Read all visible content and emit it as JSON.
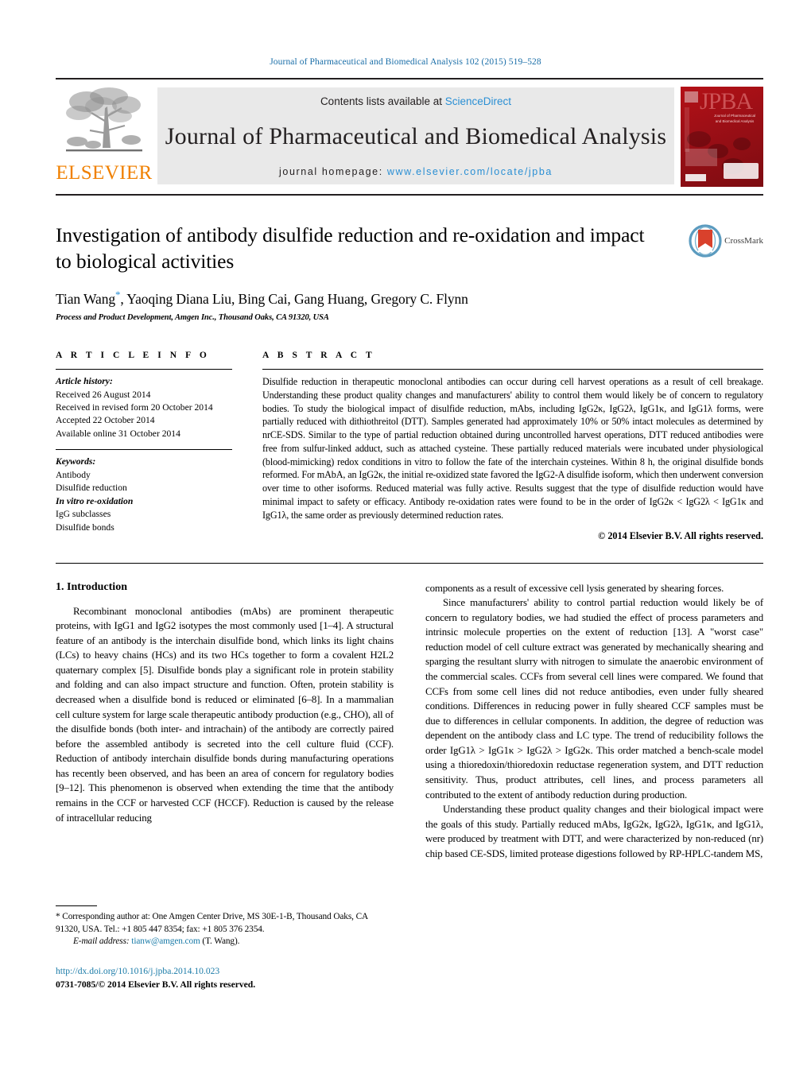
{
  "running_head": "Journal of Pharmaceutical and Biomedical Analysis 102 (2015) 519–528",
  "masthead": {
    "publisher_name": "ELSEVIER",
    "contents_prefix": "Contents lists available at ",
    "contents_link": "ScienceDirect",
    "journal_title": "Journal of Pharmaceutical and Biomedical Analysis",
    "homepage_prefix": "journal homepage: ",
    "homepage_url": "www.elsevier.com/locate/jpba",
    "cover_acronym": "JPBA",
    "cover_subtitle": "Journal of Pharmaceutical and Biomedical Analysis"
  },
  "article": {
    "title": "Investigation of antibody disulfide reduction and re-oxidation and impact to biological activities",
    "authors": "Tian Wang*, Yaoqing Diana Liu, Bing Cai, Gang Huang, Gregory C. Flynn",
    "authors_before_star": "Tian Wang",
    "authors_after_star": ", Yaoqing Diana Liu, Bing Cai, Gang Huang, Gregory C. Flynn",
    "affiliation": "Process and Product Development, Amgen Inc., Thousand Oaks, CA 91320, USA",
    "crossmark_label": "CrossMark"
  },
  "article_info": {
    "heading": "A R T I C L E   I N F O",
    "history_label": "Article history:",
    "history": [
      "Received 26 August 2014",
      "Received in revised form 20 October 2014",
      "Accepted 22 October 2014",
      "Available online 31 October 2014"
    ],
    "keywords_label": "Keywords:",
    "keywords": [
      "Antibody",
      "Disulfide reduction",
      "In vitro re-oxidation",
      "IgG subclasses",
      "Disulfide bonds"
    ]
  },
  "abstract": {
    "heading": "A B S T R A C T",
    "text": "Disulfide reduction in therapeutic monoclonal antibodies can occur during cell harvest operations as a result of cell breakage. Understanding these product quality changes and manufacturers' ability to control them would likely be of concern to regulatory bodies. To study the biological impact of disulfide reduction, mAbs, including IgG2κ, IgG2λ, IgG1κ, and IgG1λ forms, were partially reduced with dithiothreitol (DTT). Samples generated had approximately 10% or 50% intact molecules as determined by nrCE-SDS. Similar to the type of partial reduction obtained during uncontrolled harvest operations, DTT reduced antibodies were free from sulfur-linked adduct, such as attached cysteine. These partially reduced materials were incubated under physiological (blood-mimicking) redox conditions in vitro to follow the fate of the interchain cysteines. Within 8 h, the original disulfide bonds reformed. For mAbA, an IgG2κ, the initial re-oxidized state favored the IgG2-A disulfide isoform, which then underwent conversion over time to other isoforms. Reduced material was fully active. Results suggest that the type of disulfide reduction would have minimal impact to safety or efficacy. Antibody re-oxidation rates were found to be in the order of IgG2κ < IgG2λ < IgG1κ and IgG1λ, the same order as previously determined reduction rates.",
    "copyright": "© 2014 Elsevier B.V. All rights reserved."
  },
  "body": {
    "section_number_title": "1.  Introduction",
    "left_paragraphs": [
      "Recombinant monoclonal antibodies (mAbs) are prominent therapeutic proteins, with IgG1 and IgG2 isotypes the most commonly used [1–4]. A structural feature of an antibody is the interchain disulfide bond, which links its light chains (LCs) to heavy chains (HCs) and its two HCs together to form a covalent H2L2 quaternary complex [5]. Disulfide bonds play a significant role in protein stability and folding and can also impact structure and function. Often, protein stability is decreased when a disulfide bond is reduced or eliminated [6–8]. In a mammalian cell culture system for large scale therapeutic antibody production (e.g., CHO), all of the disulfide bonds (both inter- and intrachain) of the antibody are correctly paired before the assembled antibody is secreted into the cell culture fluid (CCF). Reduction of antibody interchain disulfide bonds during manufacturing operations has recently been observed, and has been an area of concern for regulatory bodies [9–12]. This phenomenon is observed when extending the time that the antibody remains in the CCF or harvested CCF (HCCF). Reduction is caused by the release of intracellular reducing"
    ],
    "right_paragraphs": [
      "components as a result of excessive cell lysis generated by shearing forces.",
      "Since manufacturers' ability to control partial reduction would likely be of concern to regulatory bodies, we had studied the effect of process parameters and intrinsic molecule properties on the extent of reduction [13]. A \"worst case\" reduction model of cell culture extract was generated by mechanically shearing and sparging the resultant slurry with nitrogen to simulate the anaerobic environment of the commercial scales. CCFs from several cell lines were compared. We found that CCFs from some cell lines did not reduce antibodies, even under fully sheared conditions. Differences in reducing power in fully sheared CCF samples must be due to differences in cellular components. In addition, the degree of reduction was dependent on the antibody class and LC type. The trend of reducibility follows the order IgG1λ > IgG1κ > IgG2λ > IgG2κ. This order matched a bench-scale model using a thioredoxin/thioredoxin reductase regeneration system, and DTT reduction sensitivity. Thus, product attributes, cell lines, and process parameters all contributed to the extent of antibody reduction during production.",
      "Understanding these product quality changes and their biological impact were the goals of this study. Partially reduced mAbs, IgG2κ, IgG2λ, IgG1κ, and IgG1λ, were produced by treatment with DTT, and were characterized by non-reduced (nr) chip based CE-SDS, limited protease digestions followed by RP-HPLC-tandem MS,"
    ]
  },
  "footnote": {
    "corresponding_line1": "* Corresponding author at: One Amgen Center Drive, MS 30E-1-B, Thousand Oaks,",
    "corresponding_line2": "CA 91320, USA. Tel.: +1 805 447 8354; fax: +1 805 376 2354.",
    "email_label": "E-mail address:",
    "email": "tianw@amgen.com",
    "email_suffix": " (T. Wang).",
    "doi": "http://dx.doi.org/10.1016/j.jpba.2014.10.023",
    "issn_copyright": "0731-7085/© 2014 Elsevier B.V. All rights reserved."
  },
  "colors": {
    "link_blue": "#1a7ba8",
    "sciencedirect_blue": "#2a8fd4",
    "elsevier_orange": "#f08000",
    "cover_red": "#b41017"
  }
}
